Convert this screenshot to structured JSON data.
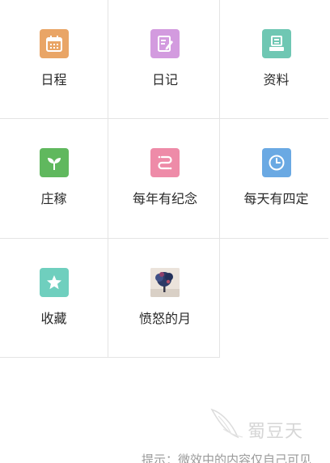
{
  "grid": {
    "items": [
      {
        "label": "日程",
        "icon": "calendar-icon",
        "color": "#E9A566"
      },
      {
        "label": "日记",
        "icon": "diary-edit-icon",
        "color": "#D39BDF"
      },
      {
        "label": "资料",
        "icon": "document-tray-icon",
        "color": "#6FC7B3"
      },
      {
        "label": "庄稼",
        "icon": "sprout-icon",
        "color": "#60B85E"
      },
      {
        "label": "每年有纪念",
        "icon": "anniversary-icon",
        "color": "#EE8BA8"
      },
      {
        "label": "每天有四定",
        "icon": "clock-icon",
        "color": "#6AA9E3"
      },
      {
        "label": "收藏",
        "icon": "star-icon",
        "color": "#6FCFBE"
      },
      {
        "label": "愤怒的月",
        "icon": "tree-photo-thumbnail"
      }
    ]
  },
  "watermark": {
    "text": "蜀豆天"
  },
  "footer": {
    "hint": "提示：微效中的内容仅自己可见"
  }
}
